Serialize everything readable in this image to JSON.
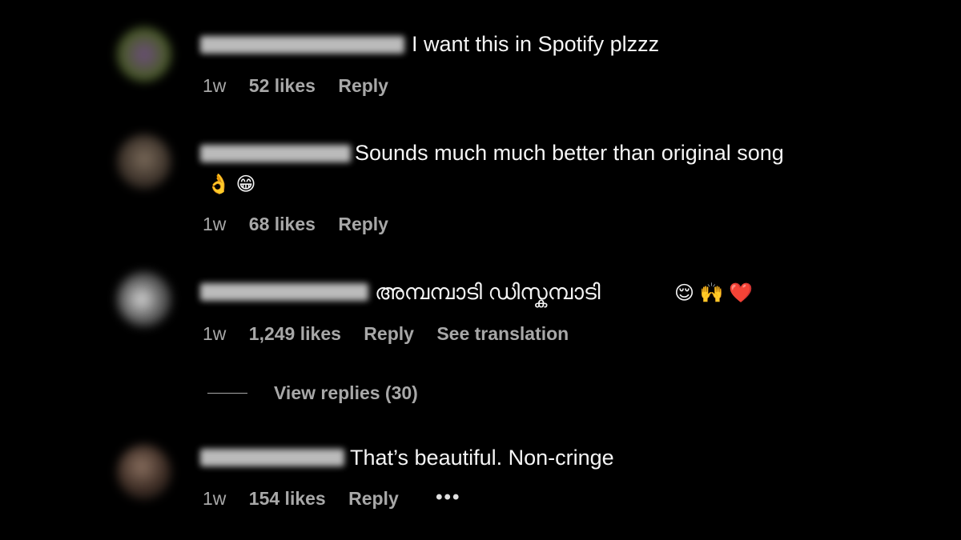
{
  "comments": [
    {
      "text": "I want this in Spotify plzzz",
      "time": "1w",
      "likes": "52 likes",
      "reply": "Reply"
    },
    {
      "text": "Sounds much much better than original song",
      "emojis": "👌 😁",
      "time": "1w",
      "likes": "68 likes",
      "reply": "Reply"
    },
    {
      "text": "അമ്പമ്പാടി ഡിസ്കമ്പാടി",
      "emojis": "😌 🙌 ❤️",
      "time": "1w",
      "likes": "1,249 likes",
      "reply": "Reply",
      "translate": "See translation"
    },
    {
      "text": "That’s beautiful. Non-cringe",
      "time": "1w",
      "likes": "154 likes",
      "reply": "Reply",
      "more": "•••"
    }
  ],
  "view_replies": "View replies (30)",
  "icons": {
    "more": "more-options-icon"
  },
  "colors": {
    "background": "#000000",
    "text": "#f5f5f5",
    "meta": "#a8a8a8"
  }
}
